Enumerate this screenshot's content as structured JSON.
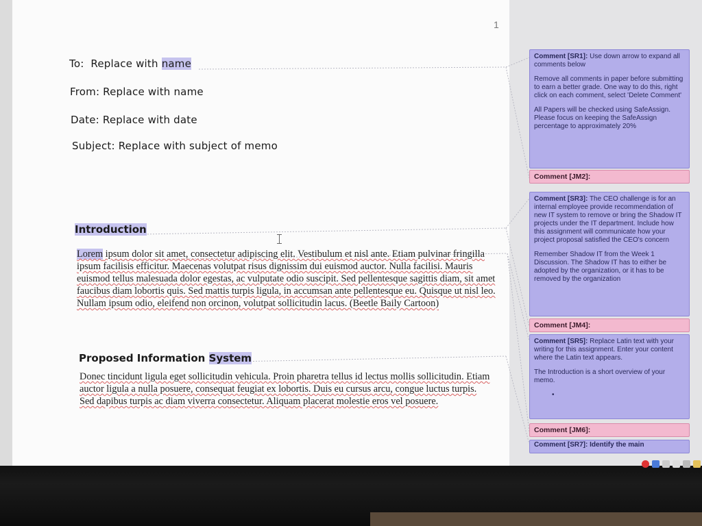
{
  "document": {
    "page_number": "1",
    "memo": {
      "to_label": "To:",
      "to_prefix": "Replace with",
      "to_highlight": "name",
      "from": "From: Replace with name",
      "date": "Date: Replace with date",
      "subject": "Subject: Replace with subject of memo"
    },
    "introduction": {
      "heading": "Introduction",
      "first_word": "Lorem",
      "paragraph": " ipsum dolor sit amet, consectetur adipiscing elit. Vestibulum et nisl ante. Etiam pulvinar fringilla ipsum facilisis efficitur. Maecenas volutpat risus dignissim dui euismod auctor. Nulla facilisi. Mauris euismod tellus malesuada dolor egestas, ac vulputate odio suscipit. Sed pellentesque sagittis diam, sit amet faucibus diam lobortis quis. Sed mattis turpis ligula, in accumsan ante pellentesque eu. Quisque ut nisl leo. Nullam ipsum odio, eleifend non orcinon, volutpat sollicitudin lacus. (Beetle Baily Cartoon)"
    },
    "proposed": {
      "heading_prefix": "Proposed Information",
      "heading_highlight": "System",
      "paragraph": "Donec tincidunt ligula eget sollicitudin vehicula. Proin pharetra tellus id lectus mollis sollicitudin. Etiam auctor ligula a nulla posuere, consequat feugiat ex lobortis. Duis eu cursus arcu, congue luctus turpis. Sed dapibus turpis ac diam viverra consectetur. Aliquam placerat molestie eros vel posuere."
    }
  },
  "comments": [
    {
      "label": "Comment [SR1]:",
      "paragraphs": [
        "Use down arrow to expand all comments below",
        "Remove all comments in paper before submitting to earn a better grade. One way to do this, right click on each comment, select 'Delete Comment'",
        "All Papers will be checked using SafeAssign. Please focus on keeping the SafeAssign percentage to approximately 20%"
      ]
    },
    {
      "label": "Comment [JM2]:"
    },
    {
      "label": "Comment [SR3]:",
      "paragraphs": [
        "The CEO challenge is for an internal employee provide recommendation of new IT system to remove or bring the Shadow IT projects under the IT department. Include how this assignment will communicate how your project proposal satisfied the CEO's concern",
        "Remember Shadow IT from the Week 1 Discussion. The Shadow IT has to either be adopted by the organization, or it has to be removed by the organization"
      ]
    },
    {
      "label": "Comment [JM4]:"
    },
    {
      "label": "Comment [SR5]:",
      "paragraphs": [
        "Replace Latin text with your writing for this assignment. Enter your content where the Latin text appears.",
        "The Introduction is a short overview of your memo.",
        "•"
      ]
    },
    {
      "label": "Comment [JM6]:"
    },
    {
      "label": "Comment [SR7]: Identify the main"
    }
  ],
  "colors": {
    "comment_blue": "#b3aeea",
    "comment_pink": "#f3b9cf",
    "highlight": "#c6c3ee",
    "spell_error": "#d96060"
  }
}
